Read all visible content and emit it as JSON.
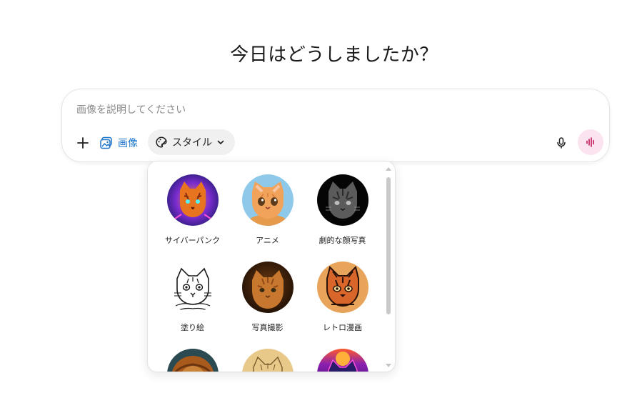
{
  "heading": "今日はどうしましたか？",
  "composer": {
    "placeholder": "画像を説明してください",
    "image_label": "画像",
    "style_label": "スタイル"
  },
  "style_menu": {
    "items": [
      {
        "label": "サイバーパンク",
        "thumbnail": "cyberpunk-cat"
      },
      {
        "label": "アニメ",
        "thumbnail": "anime-cat"
      },
      {
        "label": "劇的な顔写真",
        "thumbnail": "dramatic-portrait-cat"
      },
      {
        "label": "塗り絵",
        "thumbnail": "coloring-book-cat"
      },
      {
        "label": "写真撮影",
        "thumbnail": "photo-cat"
      },
      {
        "label": "レトロ漫画",
        "thumbnail": "retro-comic-cat"
      },
      {
        "label": "",
        "thumbnail": "lion-painting"
      },
      {
        "label": "",
        "thumbnail": "sketch-cat"
      },
      {
        "label": "",
        "thumbnail": "synthwave-cat"
      }
    ]
  },
  "colors": {
    "accent_blue": "#1a73c8",
    "voice_bg": "#fbe3ef",
    "voice_accent": "#c2185b"
  }
}
